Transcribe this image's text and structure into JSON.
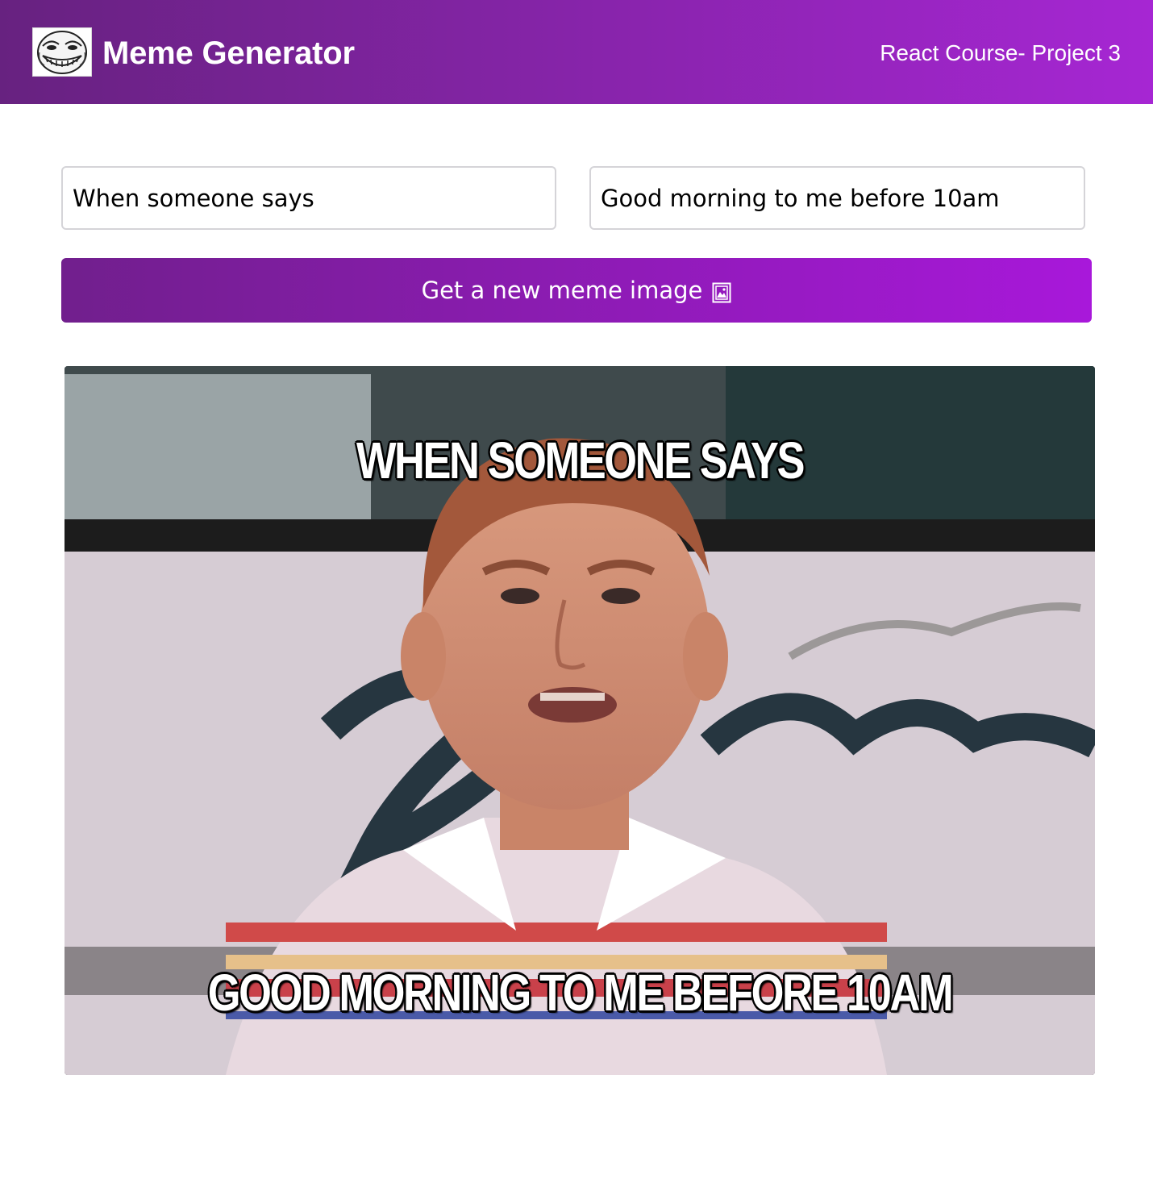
{
  "header": {
    "title": "Meme Generator",
    "subtitle": "React Course- Project 3",
    "logo_icon": "troll-face-icon"
  },
  "form": {
    "top_text": "When someone says",
    "bottom_text": "Good morning to me before 10am",
    "button_label": "Get a new meme image",
    "button_icon": "framed-picture-icon"
  },
  "meme": {
    "top_text": "When someone says",
    "bottom_text": "Good morning to me before 10am"
  },
  "colors": {
    "header_gradient_start": "#672280",
    "header_gradient_end": "#a626d3",
    "button_gradient_start": "#711f8d",
    "button_gradient_end": "#a818da"
  }
}
